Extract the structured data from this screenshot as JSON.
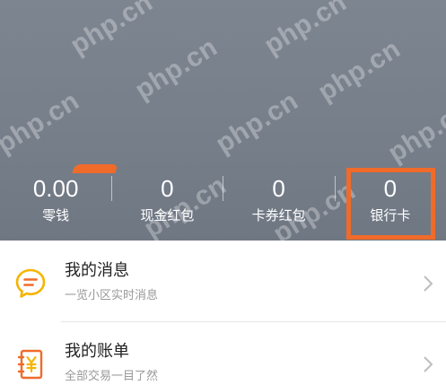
{
  "watermark": {
    "text": "php.cn"
  },
  "stats": [
    {
      "value": "0.00",
      "label": "零钱"
    },
    {
      "value": "0",
      "label": "现金红包"
    },
    {
      "value": "0",
      "label": "卡券红包"
    },
    {
      "value": "0",
      "label": "银行卡"
    }
  ],
  "list": [
    {
      "title": "我的消息",
      "subtitle": "一览小区实时消息",
      "icon": "message-icon"
    },
    {
      "title": "我的账单",
      "subtitle": "全部交易一目了然",
      "icon": "bill-icon"
    }
  ],
  "colors": {
    "header": "#767e8a",
    "accent": "#f06b2a",
    "message_icon": "#f5b400",
    "bill_icon": "#f06b2a"
  }
}
